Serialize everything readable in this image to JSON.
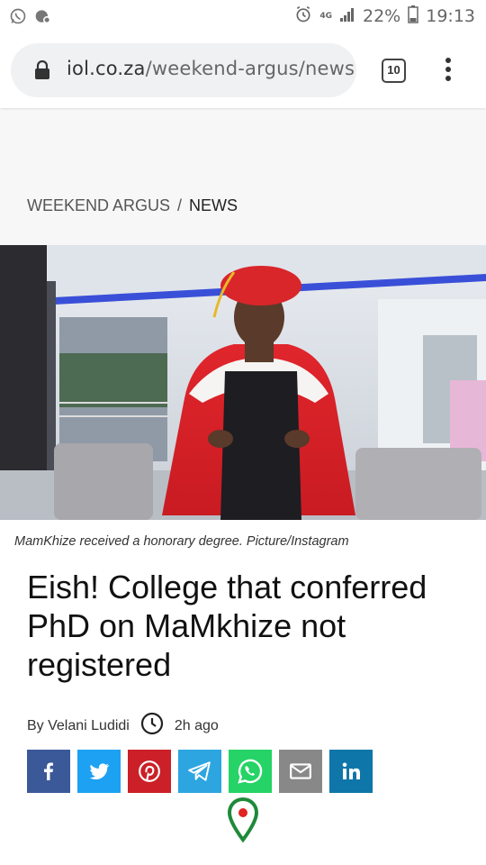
{
  "status_bar": {
    "network": "4G",
    "battery": "22%",
    "time": "19:13",
    "icons": [
      "whatsapp-icon",
      "notification-icon",
      "alarm-icon",
      "signal-icon",
      "battery-icon"
    ]
  },
  "browser": {
    "url_domain": "iol.co.za",
    "url_path": "/weekend-argus/news",
    "tab_count": "10"
  },
  "breadcrumb": {
    "section": "WEEKEND ARGUS",
    "separator": "/",
    "current": "NEWS"
  },
  "article": {
    "caption": "MamKhize received a honorary degree. Picture/Instagram",
    "headline": "Eish! College that conferred PhD on MaMkhize not registered",
    "author": "By Velani Ludidi",
    "time_ago": "2h ago"
  },
  "share": {
    "buttons": [
      "facebook",
      "twitter",
      "pinterest",
      "telegram",
      "whatsapp",
      "email",
      "linkedin"
    ],
    "colors": {
      "facebook": "#3b5998",
      "twitter": "#1da1f2",
      "pinterest": "#cb2027",
      "telegram": "#2ca5e0",
      "whatsapp": "#25d366",
      "email": "#888888",
      "linkedin": "#0e76a8"
    }
  }
}
